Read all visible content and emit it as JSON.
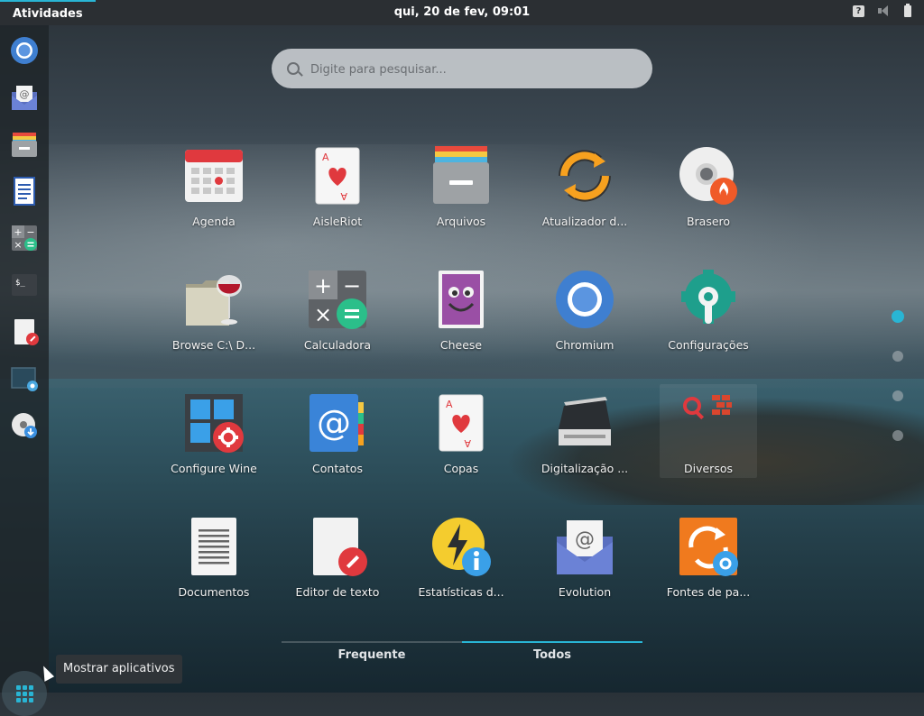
{
  "topbar": {
    "activities": "Atividades",
    "clock": "qui, 20 de fev, 09:01",
    "tray": {
      "help_icon": "?"
    }
  },
  "search": {
    "placeholder": "Digite para pesquisar..."
  },
  "dock": {
    "items": [
      "chromium-icon",
      "evolution-icon",
      "files-icon",
      "documents-icon",
      "calculator-icon",
      "terminal-icon",
      "text-editor-icon",
      "screenshot-icon",
      "disk-burner-icon"
    ],
    "show_apps_tooltip": "Mostrar aplicativos"
  },
  "apps": [
    {
      "label": "Agenda",
      "icon": "calendar-icon"
    },
    {
      "label": "AisleRiot",
      "icon": "card-heart-icon"
    },
    {
      "label": "Arquivos",
      "icon": "files-icon"
    },
    {
      "label": "Atualizador d...",
      "icon": "updater-icon"
    },
    {
      "label": "Brasero",
      "icon": "disc-burn-icon"
    },
    {
      "label": "Browse C:\\ D...",
      "icon": "wine-folder-icon"
    },
    {
      "label": "Calculadora",
      "icon": "calculator-icon"
    },
    {
      "label": "Cheese",
      "icon": "cheese-icon"
    },
    {
      "label": "Chromium",
      "icon": "chromium-icon"
    },
    {
      "label": "Configurações",
      "icon": "settings-icon"
    },
    {
      "label": "Configure Wine",
      "icon": "wine-config-icon"
    },
    {
      "label": "Contatos",
      "icon": "contacts-icon"
    },
    {
      "label": "Copas",
      "icon": "hearts-card-icon"
    },
    {
      "label": "Digitalização ...",
      "icon": "scanner-icon"
    },
    {
      "label": "Diversos",
      "icon": "folder-misc-icon"
    },
    {
      "label": "Documentos",
      "icon": "document-icon"
    },
    {
      "label": "Editor de texto",
      "icon": "text-editor-icon"
    },
    {
      "label": "Estatísticas d...",
      "icon": "power-stats-icon"
    },
    {
      "label": "Evolution",
      "icon": "evolution-icon"
    },
    {
      "label": "Fontes de pa...",
      "icon": "software-sources-icon"
    }
  ],
  "tabs": {
    "frequent": "Frequente",
    "all": "Todos",
    "active": "all"
  },
  "pages": {
    "count": 4,
    "current": 1
  },
  "colors": {
    "accent": "#29b5d4",
    "topbar": "#2b2f33"
  }
}
